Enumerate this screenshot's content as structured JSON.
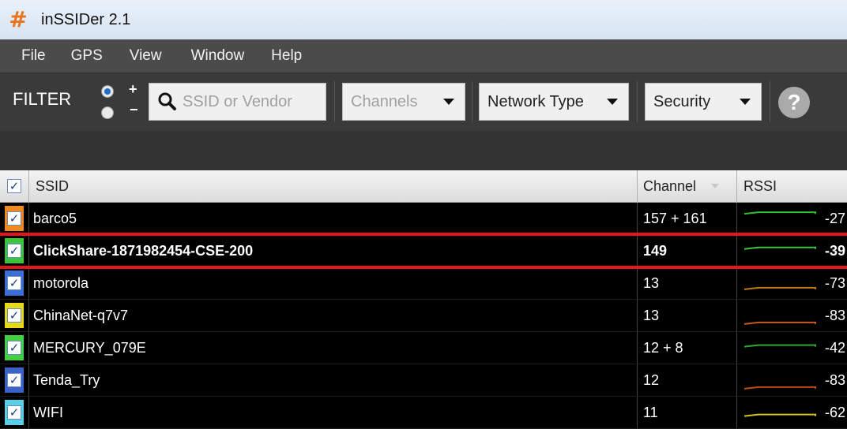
{
  "window": {
    "title": "inSSIDer 2.1",
    "icon": "hash-icon"
  },
  "menu": [
    "File",
    "GPS",
    "View",
    "Window",
    "Help"
  ],
  "toolbar": {
    "filter_label": "FILTER",
    "plus": "+",
    "minus": "−",
    "search_placeholder": "SSID or Vendor",
    "channels_label": "Channels",
    "network_type_label": "Network Type",
    "security_label": "Security",
    "help_label": "?"
  },
  "table": {
    "columns": {
      "ssid": "SSID",
      "channel": "Channel",
      "rssi": "RSSI"
    },
    "rows": [
      {
        "ssid": "barco5",
        "channel": "157 + 161",
        "rssi": "-27",
        "color": "#f08a1e",
        "line": "#2fbf2f",
        "bold": false
      },
      {
        "ssid": "ClickShare-1871982454-CSE-200",
        "channel": "149",
        "rssi": "-39",
        "color": "#3cc43c",
        "line": "#3cc43c",
        "bold": true
      },
      {
        "ssid": "motorola",
        "channel": "13",
        "rssi": "-73",
        "color": "#3a6fd8",
        "line": "#c07818",
        "bold": false
      },
      {
        "ssid": "ChinaNet-q7v7",
        "channel": "13",
        "rssi": "-83",
        "color": "#e8d81c",
        "line": "#c85a1e",
        "bold": false
      },
      {
        "ssid": "MERCURY_079E",
        "channel": "12 + 8",
        "rssi": "-42",
        "color": "#44d044",
        "line": "#2ea82e",
        "bold": false
      },
      {
        "ssid": "Tenda_Try",
        "channel": "12",
        "rssi": "-83",
        "color": "#3a62c8",
        "line": "#c04a18",
        "bold": false
      },
      {
        "ssid": "WIFI",
        "channel": "11",
        "rssi": "-62",
        "color": "#5ad0e8",
        "line": "#d4c41c",
        "bold": false
      }
    ]
  }
}
